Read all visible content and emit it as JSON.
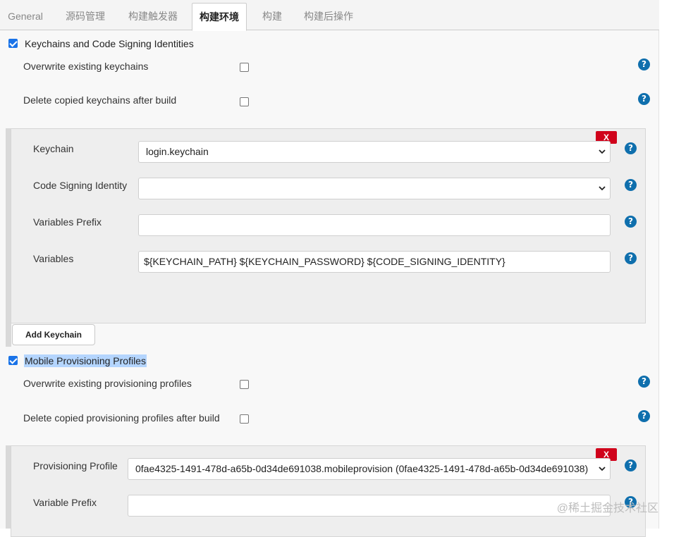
{
  "tabs": [
    {
      "label": "General"
    },
    {
      "label": "源码管理"
    },
    {
      "label": "构建触发器"
    },
    {
      "label": "构建环境"
    },
    {
      "label": "构建"
    },
    {
      "label": "构建后操作"
    }
  ],
  "keychains_section": {
    "title": "Keychains and Code Signing Identities",
    "checked": true,
    "overwrite_label": "Overwrite existing keychains",
    "delete_label": "Delete copied keychains after build",
    "entry": {
      "remove_label": "X",
      "keychain_label": "Keychain",
      "keychain_value": "login.keychain",
      "identity_label": "Code Signing Identity",
      "identity_value": "",
      "prefix_label": "Variables Prefix",
      "prefix_value": "",
      "variables_label": "Variables",
      "variables_value": "${KEYCHAIN_PATH} ${KEYCHAIN_PASSWORD} ${CODE_SIGNING_IDENTITY}"
    },
    "add_button": "Add Keychain"
  },
  "profiles_section": {
    "title": "Mobile Provisioning Profiles",
    "checked": true,
    "overwrite_label": "Overwrite existing provisioning profiles",
    "delete_label": "Delete copied provisioning profiles after build",
    "entry": {
      "remove_label": "X",
      "profile_label": "Provisioning Profile",
      "profile_value": "0fae4325-1491-478d-a65b-0d34de691038.mobileprovision (0fae4325-1491-478d-a65b-0d34de691038)",
      "prefix_label": "Variable Prefix",
      "prefix_value": ""
    }
  },
  "help_glyph": "?",
  "watermark": "@稀土掘金技术社区",
  "colors": {
    "accent": "#1a73e8",
    "help": "#0f6fad",
    "remove": "#d0021b",
    "selection": "#b4d5fe"
  }
}
